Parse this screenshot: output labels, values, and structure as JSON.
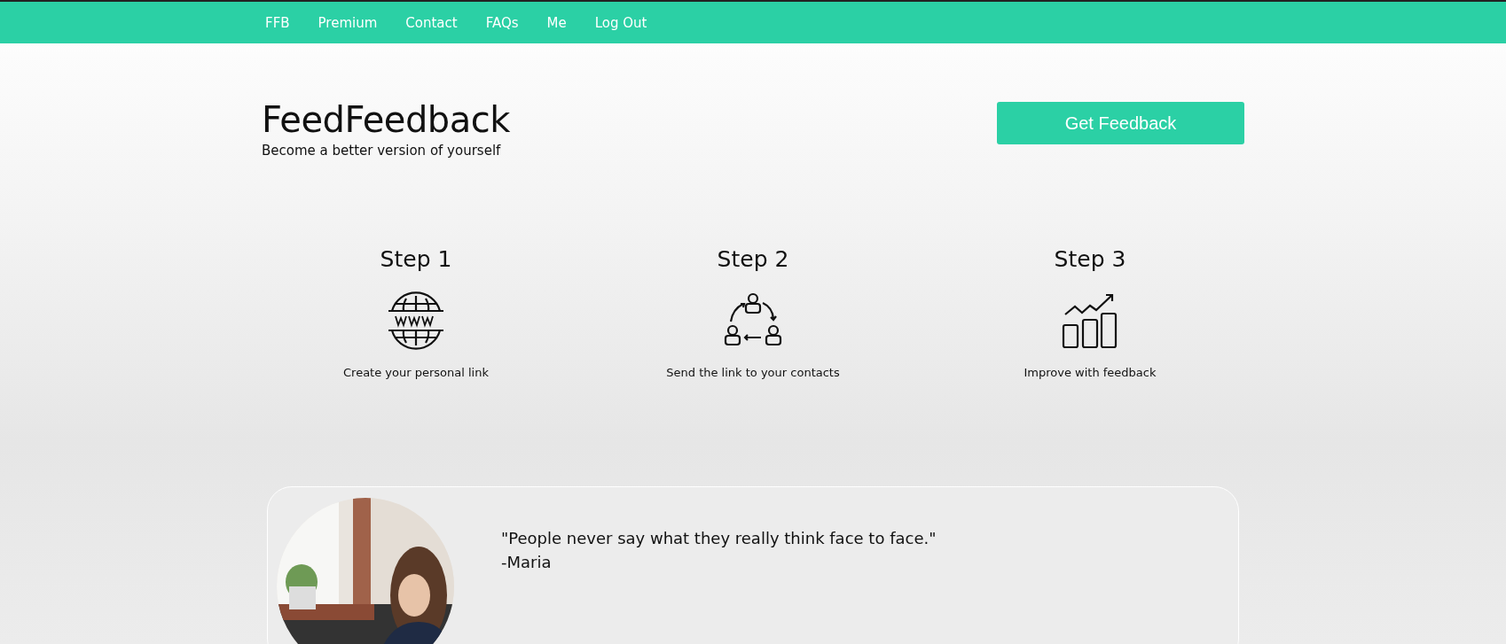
{
  "nav": {
    "items": [
      {
        "label": "FFB"
      },
      {
        "label": "Premium"
      },
      {
        "label": "Contact"
      },
      {
        "label": "FAQs"
      },
      {
        "label": "Me"
      },
      {
        "label": "Log Out"
      }
    ]
  },
  "hero": {
    "title": "FeedFeedback",
    "subtitle": "Become a better version of yourself",
    "button": "Get Feedback"
  },
  "steps": [
    {
      "title": "Step 1",
      "kind": "globe",
      "caption": "Create your personal link"
    },
    {
      "title": "Step 2",
      "kind": "people",
      "caption": "Send the link to your contacts"
    },
    {
      "title": "Step 3",
      "kind": "chart",
      "caption": "Improve with feedback"
    }
  ],
  "testimonial": {
    "quote": "\"People never say what they really think face to face.\"",
    "author": "-Maria"
  }
}
